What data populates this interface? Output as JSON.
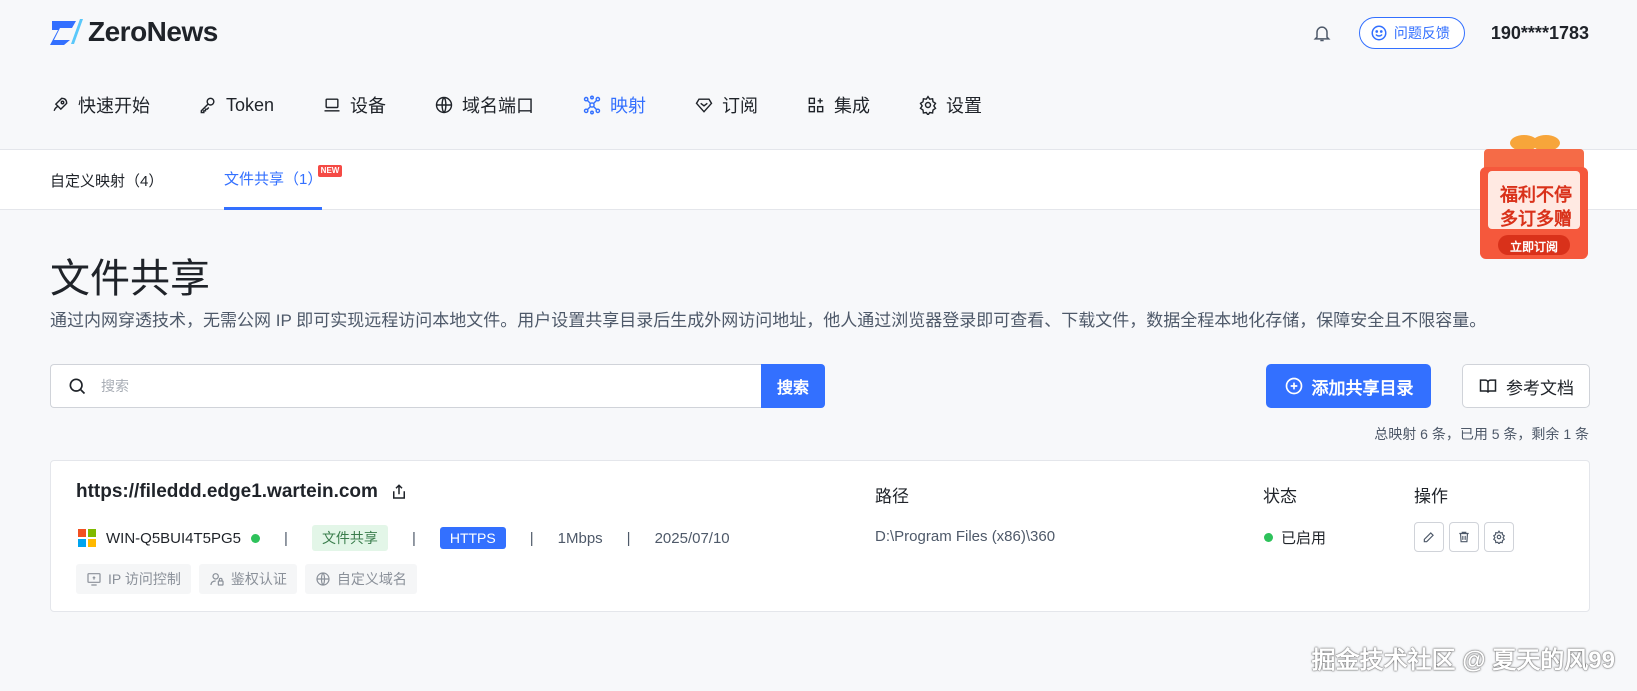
{
  "header": {
    "brand": "ZeroNews",
    "feedback_label": "问题反馈",
    "user_phone": "190****1783"
  },
  "nav": {
    "items": [
      {
        "label": "快速开始",
        "icon": "rocket-icon"
      },
      {
        "label": "Token",
        "icon": "key-icon"
      },
      {
        "label": "设备",
        "icon": "laptop-icon"
      },
      {
        "label": "域名端口",
        "icon": "globe-icon"
      },
      {
        "label": "映射",
        "icon": "network-icon",
        "active": true
      },
      {
        "label": "订阅",
        "icon": "diamond-icon"
      },
      {
        "label": "集成",
        "icon": "apps-icon"
      },
      {
        "label": "设置",
        "icon": "gear-icon"
      }
    ]
  },
  "subtabs": {
    "custom_mapping": "自定义映射（4）",
    "file_share": "文件共享（1）",
    "new_badge": "NEW"
  },
  "promo": {
    "line1": "福利不停",
    "line2": "多订多赠",
    "button": "立即订阅"
  },
  "page": {
    "title": "文件共享",
    "description": "通过内网穿透技术，无需公网 IP 即可实现远程访问本地文件。用户设置共享目录后生成外网访问地址，他人通过浏览器登录即可查看、下载文件，数据全程本地化存储，保障安全且不限容量。"
  },
  "toolbar": {
    "search_placeholder": "搜索",
    "search_button": "搜索",
    "add_button": "添加共享目录",
    "docs_button": "参考文档",
    "quota_text": "总映射 6 条，已用 5 条，剩余 1 条"
  },
  "columns": {
    "path": "路径",
    "status": "状态",
    "actions": "操作"
  },
  "mapping": {
    "url": "https://fileddd.edge1.wartein.com",
    "device": "WIN-Q5BUI4T5PG5",
    "type_tag": "文件共享",
    "protocol": "HTTPS",
    "bandwidth": "1Mbps",
    "date": "2025/07/10",
    "path": "D:\\Program Files (x86)\\360",
    "status": "已启用",
    "features": [
      "IP 访问控制",
      "鉴权认证",
      "自定义域名"
    ]
  },
  "colors": {
    "primary": "#3370ff",
    "success": "#2ec25b",
    "promo": "#f5583c"
  },
  "watermark": "掘金技术社区 @ 夏天的风99"
}
